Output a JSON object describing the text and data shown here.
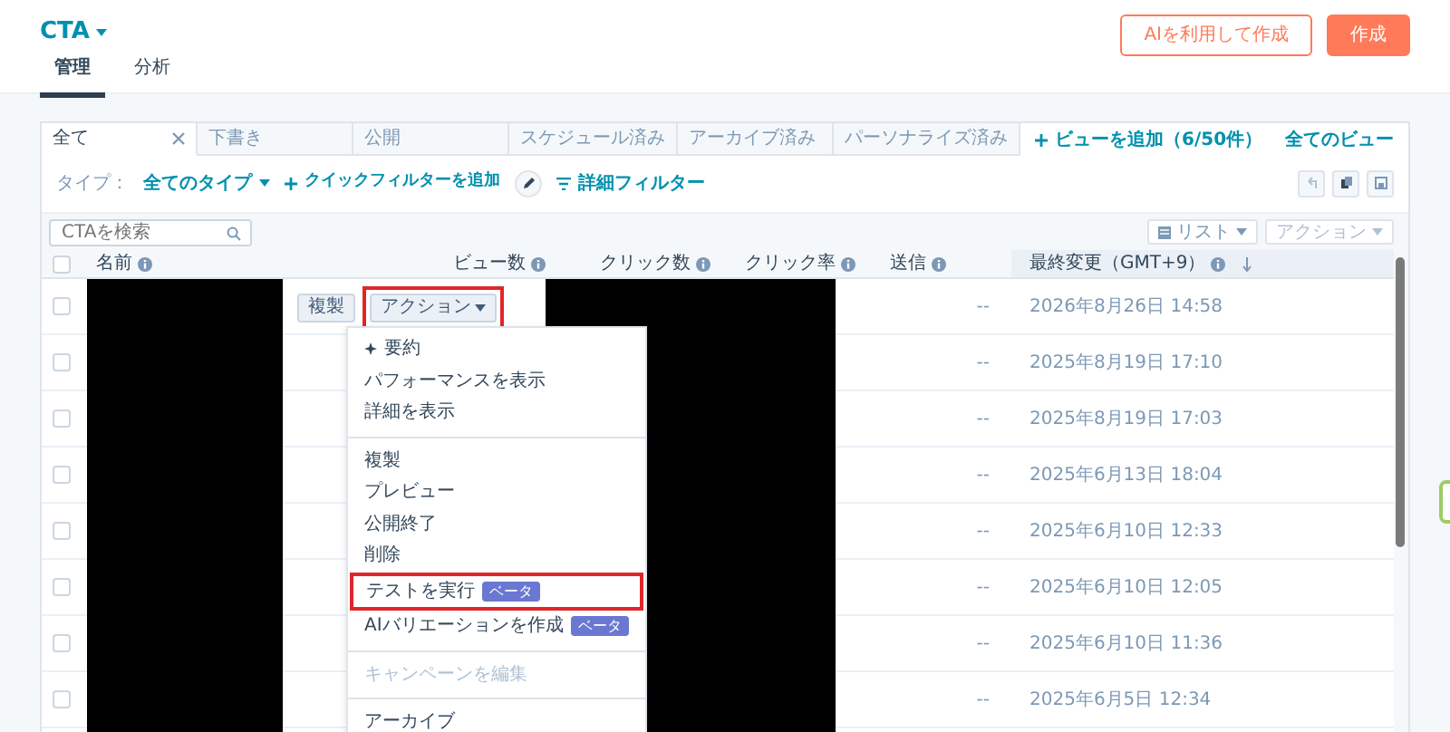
{
  "header": {
    "title": "CTA",
    "tabs": [
      {
        "label": "管理",
        "selected": true
      },
      {
        "label": "分析",
        "selected": false
      }
    ],
    "buttons": [
      {
        "label": "AIを利用して作成",
        "kind": "outline"
      },
      {
        "label": "作成",
        "kind": "primary"
      }
    ]
  },
  "view_tabs": [
    {
      "label": "全て",
      "selected": true,
      "closable": true
    },
    {
      "label": "下書き",
      "selected": false,
      "closable": false
    },
    {
      "label": "公開",
      "selected": false,
      "closable": false
    },
    {
      "label": "スケジュール済み",
      "selected": false,
      "closable": false
    },
    {
      "label": "アーカイブ済み",
      "selected": false,
      "closable": false
    },
    {
      "label": "パーソナライズ済み",
      "selected": false,
      "closable": false
    }
  ],
  "add_view": "ビューを追加（6/50件）",
  "all_views": "全てのビュー",
  "filters": {
    "type_label": "タイプ：",
    "type_value": "全てのタイプ",
    "quick_filter": "クイックフィルターを追加",
    "advanced_filter": "詳細フィルター"
  },
  "search": {
    "placeholder": "CTAを検索"
  },
  "list_button": {
    "label": "リスト",
    "disabled": false
  },
  "actions_button": {
    "label": "アクション",
    "disabled": true
  },
  "table": {
    "all_checked": false,
    "columns": [
      {
        "label": "名前",
        "sorted": false
      },
      {
        "label": "ビュー数",
        "sorted": false
      },
      {
        "label": "クリック数",
        "sorted": false
      },
      {
        "label": "クリック率",
        "sorted": false
      },
      {
        "label": "送信",
        "sorted": false
      },
      {
        "label": "最終変更（GMT+9）",
        "sorted": true
      }
    ],
    "rows": [
      {
        "checked": false,
        "send": "--",
        "last_modified": "2026年8月26日 14:58",
        "hover_buttons": [
          {
            "label": "複製",
            "highlighted": false,
            "caret": false
          },
          {
            "label": "アクション",
            "highlighted": true,
            "caret": true
          }
        ]
      },
      {
        "checked": false,
        "send": "--",
        "last_modified": "2025年8月19日 17:10"
      },
      {
        "checked": false,
        "send": "--",
        "last_modified": "2025年8月19日 17:03"
      },
      {
        "checked": false,
        "send": "--",
        "last_modified": "2025年6月13日 18:04"
      },
      {
        "checked": false,
        "send": "--",
        "last_modified": "2025年6月10日 12:33"
      },
      {
        "checked": false,
        "send": "--",
        "last_modified": "2025年6月10日 12:05"
      },
      {
        "checked": false,
        "send": "--",
        "last_modified": "2025年6月10日 11:36"
      },
      {
        "checked": false,
        "send": "--",
        "last_modified": "2025年6月5日 12:34"
      }
    ]
  },
  "menu": {
    "items": [
      {
        "kind": "featured",
        "label": "要約",
        "disabled": false,
        "highlighted": false
      },
      {
        "kind": "item",
        "label": "パフォーマンスを表示",
        "disabled": false,
        "highlighted": false
      },
      {
        "kind": "item",
        "label": "詳細を表示",
        "disabled": false,
        "highlighted": false
      },
      {
        "kind": "divider"
      },
      {
        "kind": "item",
        "label": "複製",
        "disabled": false,
        "highlighted": false
      },
      {
        "kind": "item",
        "label": "プレビュー",
        "disabled": false,
        "highlighted": false
      },
      {
        "kind": "item",
        "label": "公開終了",
        "disabled": false,
        "highlighted": false
      },
      {
        "kind": "item",
        "label": "削除",
        "disabled": false,
        "highlighted": false
      },
      {
        "kind": "item",
        "label": "テストを実行",
        "badge": "ベータ",
        "disabled": false,
        "highlighted": true
      },
      {
        "kind": "item",
        "label": "AIバリエーションを作成",
        "badge": "ベータ",
        "disabled": false,
        "highlighted": false
      },
      {
        "kind": "divider"
      },
      {
        "kind": "item",
        "label": "キャンペーンを編集",
        "disabled": true,
        "highlighted": false
      },
      {
        "kind": "divider"
      },
      {
        "kind": "item",
        "label": "アーカイブ",
        "disabled": false,
        "highlighted": false
      }
    ]
  }
}
